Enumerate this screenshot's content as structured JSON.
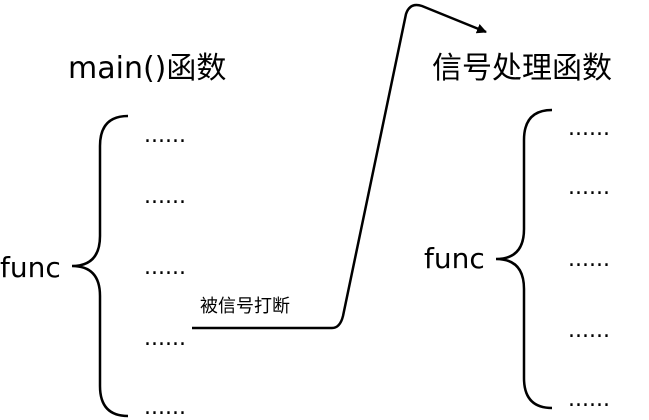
{
  "left": {
    "title": "main()函数",
    "func_label": "func",
    "lines": [
      "......",
      "......",
      "......",
      "......",
      "......"
    ]
  },
  "right": {
    "title": "信号处理函数",
    "func_label": "func",
    "lines": [
      "......",
      "......",
      "......",
      "......",
      "......"
    ]
  },
  "edge": {
    "label": "被信号打断"
  },
  "colors": {
    "stroke": "#000000",
    "text": "#000000",
    "background": "#ffffff"
  }
}
